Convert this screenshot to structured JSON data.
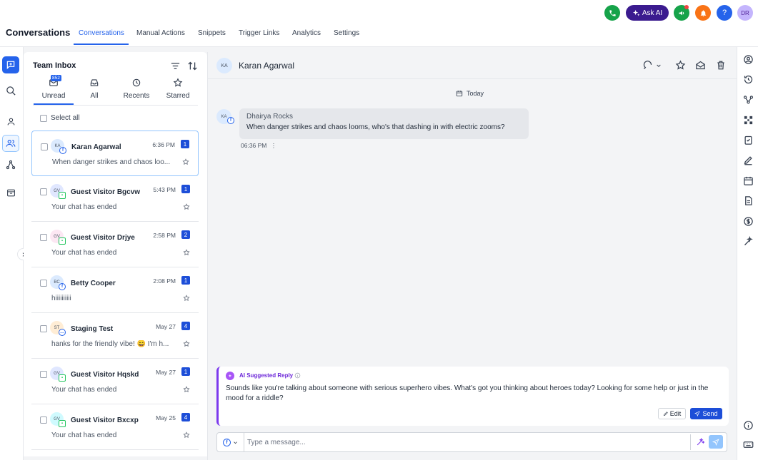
{
  "app_title": "Conversations",
  "nav_tabs": [
    "Conversations",
    "Manual Actions",
    "Snippets",
    "Trigger Links",
    "Analytics",
    "Settings"
  ],
  "topbar": {
    "ask_ai_label": "Ask AI",
    "user_initials": "DR",
    "help_label": "?"
  },
  "inbox": {
    "title": "Team Inbox",
    "unread_count": "852",
    "tabs": [
      "Unread",
      "All",
      "Recents",
      "Starred"
    ],
    "select_all_label": "Select all",
    "conversations": [
      {
        "initials": "KA",
        "name": "Karan Agarwal",
        "time": "6:36 PM",
        "count": "1",
        "preview": "When danger strikes and chaos loo...",
        "avatar_color": "#dbeafe",
        "channel": "facebook"
      },
      {
        "initials": "GV",
        "name": "Guest Visitor Bgcvw",
        "time": "5:43 PM",
        "count": "1",
        "preview": "Your chat has ended",
        "avatar_color": "#e0e7ff",
        "channel": "chat"
      },
      {
        "initials": "GV",
        "name": "Guest Visitor Drjye",
        "time": "2:58 PM",
        "count": "2",
        "preview": "Your chat has ended",
        "avatar_color": "#fce7f3",
        "channel": "chat"
      },
      {
        "initials": "BC",
        "name": "Betty Cooper",
        "time": "2:08 PM",
        "count": "1",
        "preview": "hiiiiiiiiii",
        "avatar_color": "#dbeafe",
        "channel": "facebook"
      },
      {
        "initials": "ST",
        "name": "Staging Test",
        "time": "May 27",
        "count": "4",
        "preview": "hanks for the friendly vibe! 😄 I'm h...",
        "avatar_color": "#ffedd5",
        "channel": "sms"
      },
      {
        "initials": "GV",
        "name": "Guest Visitor Hqskd",
        "time": "May 27",
        "count": "1",
        "preview": "Your chat has ended",
        "avatar_color": "#e0e7ff",
        "channel": "chat"
      },
      {
        "initials": "GV",
        "name": "Guest Visitor Bxcxp",
        "time": "May 25",
        "count": "4",
        "preview": "Your chat has ended",
        "avatar_color": "#cffafe",
        "channel": "chat"
      }
    ]
  },
  "chat": {
    "contact_initials": "KA",
    "contact_name": "Karan Agarwal",
    "date_label": "Today",
    "message": {
      "sender": "Dhairya Rocks",
      "text": "When danger strikes and chaos looms, who's that dashing in with electric zooms?",
      "time": "06:36 PM"
    },
    "ai_suggestion": {
      "title": "AI Suggested Reply",
      "text": "Sounds like you're talking about someone with serious superhero vibes. What's got you thinking about heroes today? Looking for some help or just in the mood for a riddle?",
      "edit_label": "Edit",
      "send_label": "Send"
    },
    "composer_placeholder": "Type a message..."
  },
  "colors": {
    "accent": "#2563eb",
    "ai_purple": "#7c3aed",
    "ask_ai_bg": "#3b1b8f"
  }
}
